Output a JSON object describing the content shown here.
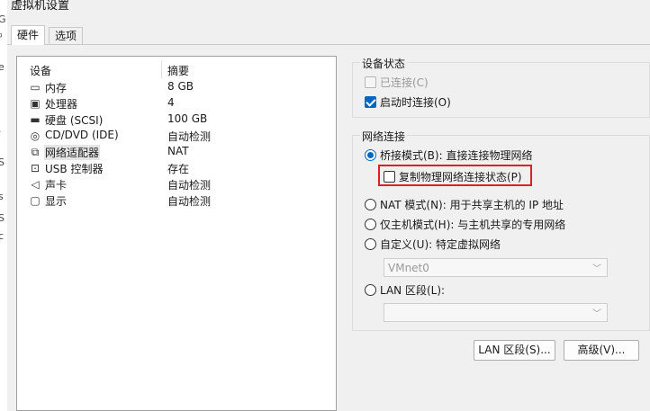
{
  "window": {
    "title": "虚拟机设置"
  },
  "edge_text": [
    "G",
    "ᵍ",
    "e",
    "·",
    "S",
    "s",
    "S",
    "c"
  ],
  "tabs": [
    {
      "label": "硬件",
      "active": true
    },
    {
      "label": "选项",
      "active": false
    }
  ],
  "device_list": {
    "headers": {
      "device": "设备",
      "summary": "摘要"
    },
    "rows": [
      {
        "icon": "memory-icon",
        "glyph": "▭",
        "name": "内存",
        "summary": "8 GB"
      },
      {
        "icon": "processor-icon",
        "glyph": "▣",
        "name": "处理器",
        "summary": "4"
      },
      {
        "icon": "hard-disk-icon",
        "glyph": "▬",
        "name": "硬盘 (SCSI)",
        "summary": "100 GB"
      },
      {
        "icon": "cd-dvd-icon",
        "glyph": "◎",
        "name": "CD/DVD (IDE)",
        "summary": "自动检测"
      },
      {
        "icon": "network-adapter-icon",
        "glyph": "⧉",
        "name": "网络适配器",
        "summary": "NAT",
        "selected": true
      },
      {
        "icon": "usb-icon",
        "glyph": "⊡",
        "name": "USB 控制器",
        "summary": "存在"
      },
      {
        "icon": "sound-card-icon",
        "glyph": "◁",
        "name": "声卡",
        "summary": "自动检测"
      },
      {
        "icon": "display-icon",
        "glyph": "▢",
        "name": "显示",
        "summary": "自动检测"
      }
    ]
  },
  "device_status": {
    "title": "设备状态",
    "connected": {
      "label": "已连接(C)",
      "checked": false,
      "enabled": false
    },
    "connect_at_power_on": {
      "label": "启动时连接(O)",
      "checked": true,
      "enabled": true
    }
  },
  "network_connection": {
    "title": "网络连接",
    "bridged": {
      "label": "桥接模式(B): 直接连接物理网络",
      "selected": true
    },
    "replicate_state": {
      "label": "复制物理网络连接状态(P)",
      "checked": false
    },
    "nat": {
      "label": "NAT 模式(N): 用于共享主机的 IP 地址",
      "selected": false
    },
    "host_only": {
      "label": "仅主机模式(H): 与主机共享的专用网络",
      "selected": false
    },
    "custom": {
      "label": "自定义(U): 特定虚拟网络",
      "selected": false
    },
    "custom_select_value": "VMnet0",
    "lan_segment": {
      "label": "LAN 区段(L):",
      "selected": false
    },
    "lan_select_value": ""
  },
  "buttons": {
    "lan_segments": "LAN 区段(S)...",
    "advanced": "高级(V)..."
  },
  "colors": {
    "accent": "#0067c0",
    "highlight": "#e02020"
  }
}
